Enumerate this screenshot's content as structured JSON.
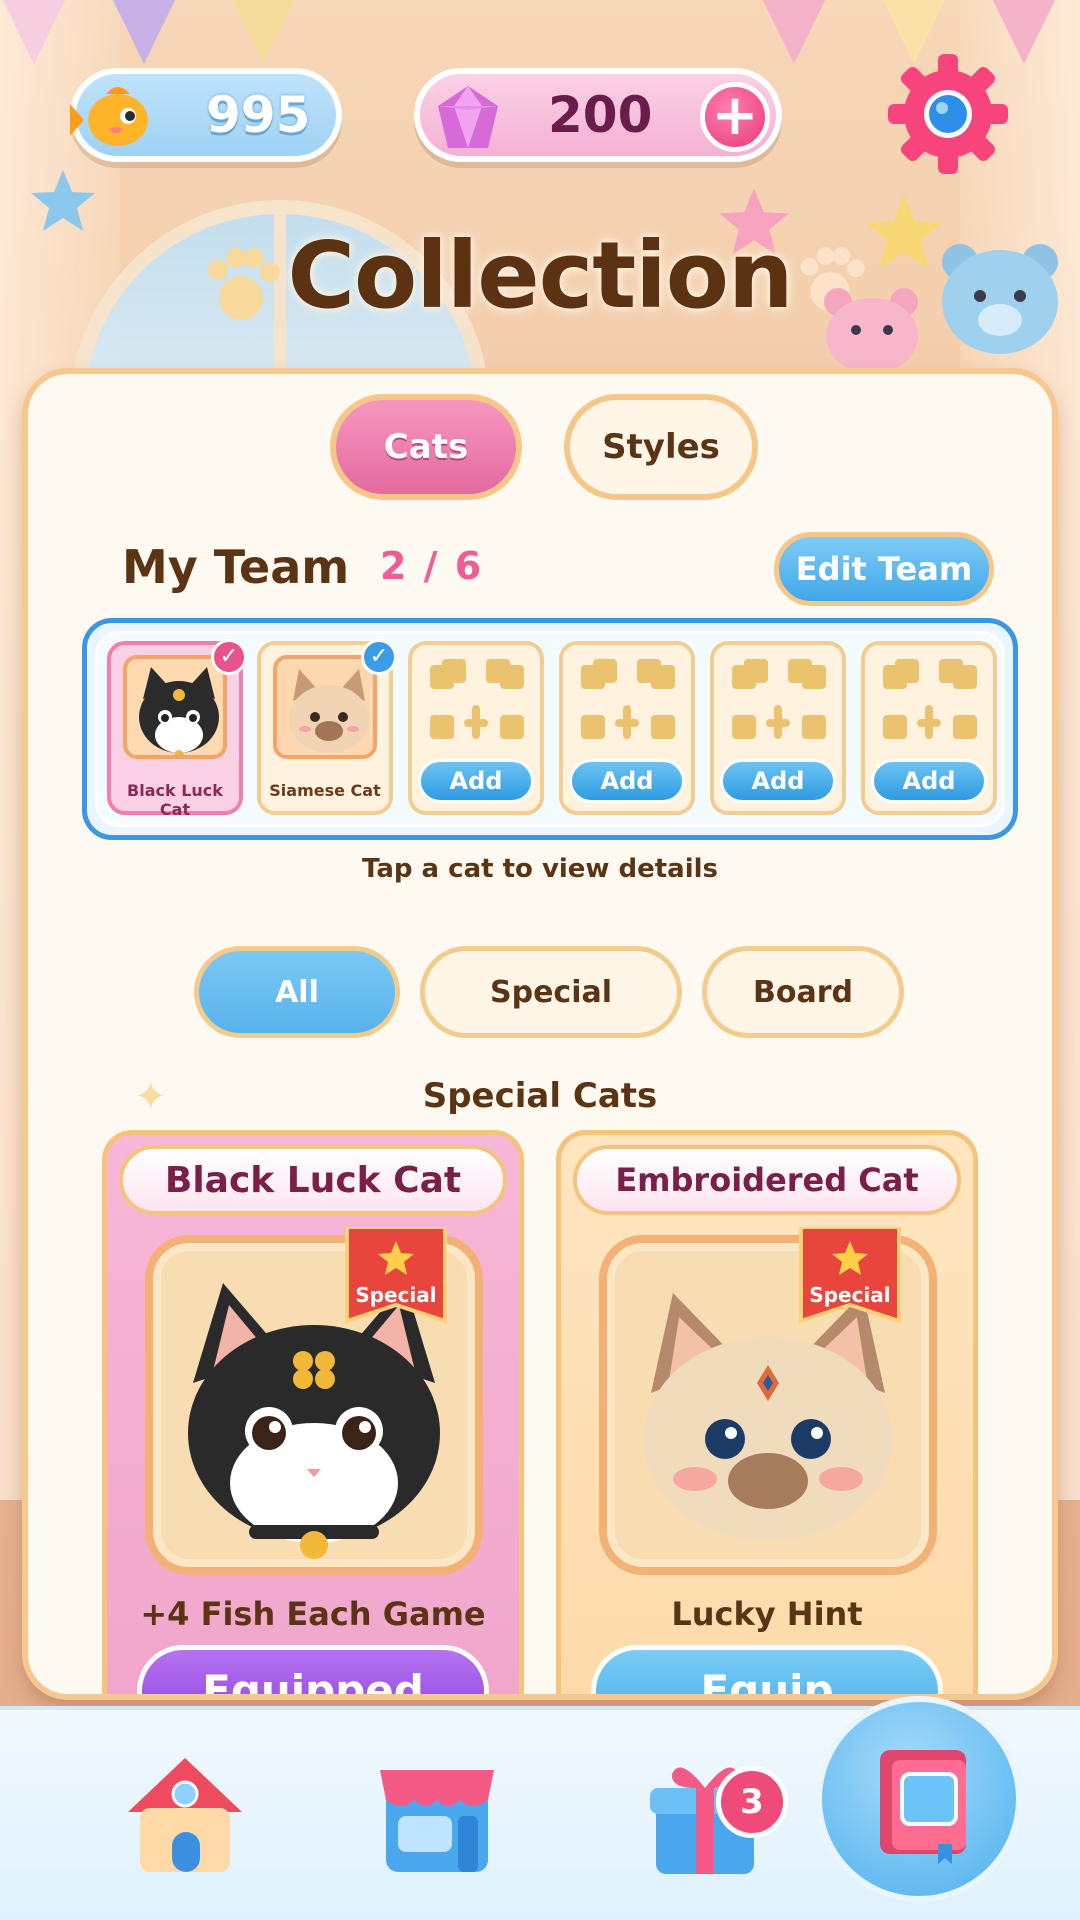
{
  "currency": {
    "fish": "995",
    "gems": "200",
    "add_gems_symbol": "+"
  },
  "title": "Collection",
  "tabs": [
    {
      "label": "Cats",
      "active": true
    },
    {
      "label": "Styles",
      "active": false
    }
  ],
  "team": {
    "title": "My Team",
    "count": "2 / 6",
    "edit_label": "Edit Team",
    "slots": [
      {
        "name": "Black Luck Cat",
        "selected": true
      },
      {
        "name": "Siamese Cat",
        "selected": true
      },
      {
        "add_label": "Add"
      },
      {
        "add_label": "Add"
      },
      {
        "add_label": "Add"
      },
      {
        "add_label": "Add"
      }
    ],
    "check_symbol": "✓"
  },
  "hint": "Tap a cat to view details",
  "filters": [
    {
      "label": "All",
      "active": true
    },
    {
      "label": "Special",
      "active": false
    },
    {
      "label": "Board",
      "active": false
    }
  ],
  "section_title": "Special Cats",
  "cards": [
    {
      "name": "Black Luck Cat",
      "tag": "Special",
      "perk": "+4 Fish Each Game",
      "button": "Equipped"
    },
    {
      "name": "Embroidered Cat",
      "tag": "Special",
      "perk": "Lucky Hint",
      "button": "Equip"
    }
  ],
  "nav": {
    "gift_badge": "3",
    "items": [
      "home-icon",
      "shop-icon",
      "gift-icon",
      "collection-book-icon"
    ]
  },
  "colors": {
    "accent_pink": "#e46aa0",
    "accent_blue": "#40a8ea",
    "brown_text": "#5a3414",
    "panel_bg": "#fffaf1"
  }
}
